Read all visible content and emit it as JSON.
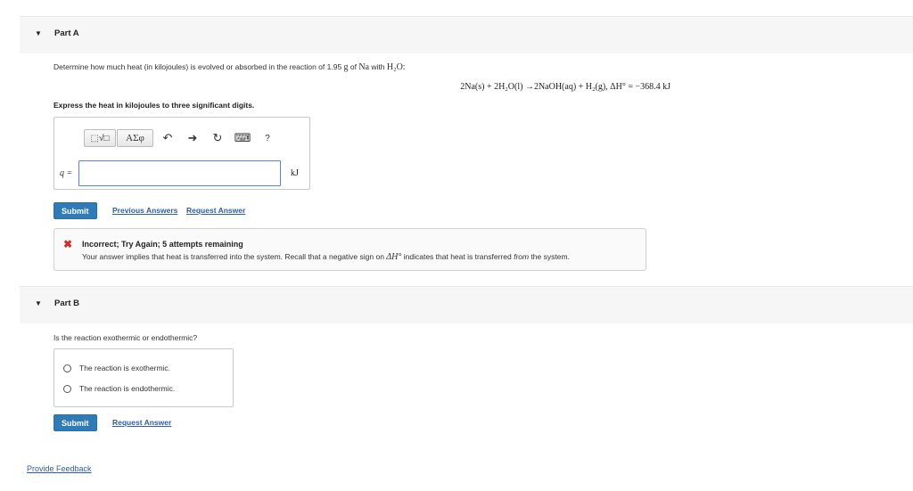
{
  "partA": {
    "title": "Part A",
    "prompt_text": "Determine how much heat (in kilojoules) is evolved or absorbed in the reaction of 1.95 ",
    "prompt_g": "g",
    "prompt_of": " of ",
    "prompt_na": "Na",
    "prompt_with": " with ",
    "prompt_h2o": "H₂O:",
    "equation": "2Na(s) + 2H₂O(l) →2NaOH(aq) + H₂(g),    ΔH° = −368.4 kJ",
    "instruction": "Express the heat in kilojoules to three significant digits.",
    "toolbar": {
      "templates_label": "⬚√□",
      "greek_label": "AΣφ",
      "undo": "↶",
      "redo": "➜",
      "reset": "↻",
      "keyboard": "⌨",
      "help": "?"
    },
    "input_label": "q =",
    "input_value": "",
    "unit": "kJ",
    "submit_label": "Submit",
    "previous_answers_label": "Previous Answers",
    "request_answer_label": "Request Answer",
    "feedback": {
      "icon": "✖",
      "title": "Incorrect; Try Again; 5 attempts remaining",
      "msg_start": "Your answer implies that heat is transferred into the system. Recall that a negative sign on ",
      "msg_math": "ΔH°",
      "msg_mid": " indicates that heat is transferred ",
      "msg_from": "from",
      "msg_end": " the system."
    }
  },
  "partB": {
    "title": "Part B",
    "prompt": "Is the reaction exothermic or endothermic?",
    "options": [
      "The reaction is exothermic.",
      "The reaction is endothermic."
    ],
    "submit_label": "Submit",
    "request_answer_label": "Request Answer"
  },
  "provide_feedback_label": "Provide Feedback",
  "colors": {
    "submit_bg": "#2f7bb8",
    "link": "#2e5fa8",
    "error": "#d42b2b"
  }
}
